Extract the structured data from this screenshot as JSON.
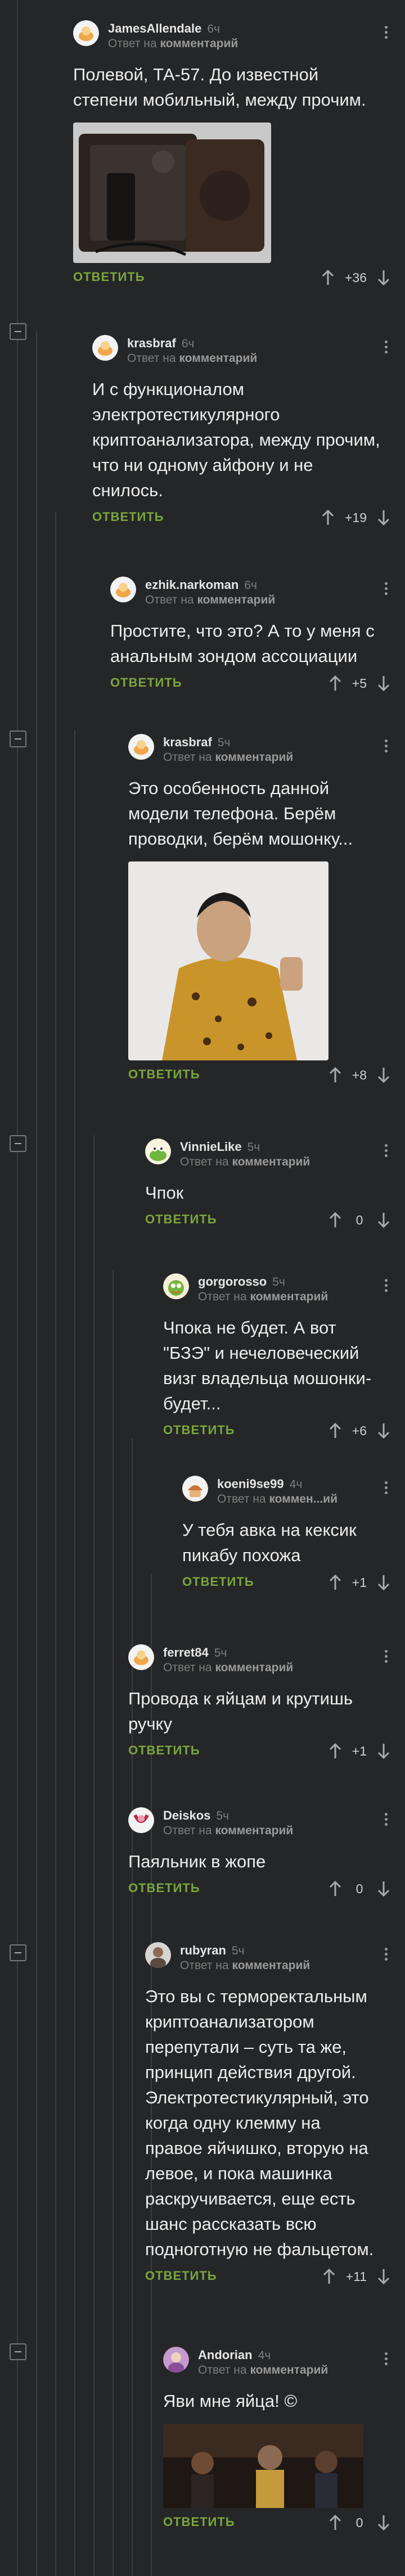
{
  "labels": {
    "reply_button": "ОТВЕТИТЬ",
    "reply_to_prefix": "Ответ на",
    "reply_to_target": "комментарий",
    "reply_to_short": "коммен...ий"
  },
  "comments": [
    {
      "author": "JamesAllendale",
      "time": "6ч",
      "reply_to": "Ответ на",
      "reply_target": "комментарий",
      "text": "Полевой, ТА-57. До известной степени мобильный, между прочим.",
      "score": "+36",
      "image": "field-telephone-photo"
    },
    {
      "author": "krasbraf",
      "time": "6ч",
      "reply_to": "Ответ на",
      "reply_target": "комментарий",
      "text": "И с функционалом электротестикулярного криптоанализатора, между прочим, что ни одному айфону и не снилось.",
      "score": "+19"
    },
    {
      "author": "ezhik.narkoman",
      "time": "6ч",
      "reply_to": "Ответ на",
      "reply_target": "комментарий",
      "text": "Простите, что это? А то у меня с анальным зондом ассоциации",
      "score": "+5"
    },
    {
      "author": "krasbraf",
      "time": "5ч",
      "reply_to": "Ответ на",
      "reply_target": "комментарий",
      "text": "Это особенность данной модели телефона. Берём проводки, берём мошонку...",
      "score": "+8",
      "image": "man-in-leopard-outfit-photo"
    },
    {
      "author": "VinnieLike",
      "time": "5ч",
      "reply_to": "Ответ на",
      "reply_target": "комментарий",
      "text": "Чпок",
      "score": "0"
    },
    {
      "author": "gorgorosso",
      "time": "5ч",
      "reply_to": "Ответ на",
      "reply_target": "комментарий",
      "text": "Чпока не будет. А вот \"БЗЭ\" и нечеловеческий визг владельца мошонки-будет...",
      "score": "+6"
    },
    {
      "author": "koeni9se99",
      "time": "4ч",
      "reply_to": "Ответ на",
      "reply_target": "коммен...ий",
      "text": "У тебя авка на кексик пикабу похожа",
      "score": "+1"
    },
    {
      "author": "ferret84",
      "time": "5ч",
      "reply_to": "Ответ на",
      "reply_target": "комментарий",
      "text": "Провода к яйцам и крутишь ручку",
      "score": "+1"
    },
    {
      "author": "Deiskos",
      "time": "5ч",
      "reply_to": "Ответ на",
      "reply_target": "комментарий",
      "text": "Паяльник в жопе",
      "score": "0"
    },
    {
      "author": "rubyran",
      "time": "5ч",
      "reply_to": "Ответ на",
      "reply_target": "комментарий",
      "text": "Это вы с терморектальным криптоанализатором перепутали – суть та же, принцип действия другой. Электротестикулярный, это когда одну клемму на правое яйчишко, вторую на левое, и пока машинка раскручивается, еще есть шанс рассказать всю подноготную не фальцетом.",
      "score": "+11"
    },
    {
      "author": "Andorian",
      "time": "4ч",
      "reply_to": "Ответ на",
      "reply_target": "комментарий",
      "text": "Яви мне яйца! ©",
      "score": "0",
      "image": "crowd-scene-photo"
    }
  ],
  "colors": {
    "background": "#252627",
    "reply_accent": "#7aa63d",
    "text": "#ededed",
    "muted": "#7d7d7d"
  }
}
